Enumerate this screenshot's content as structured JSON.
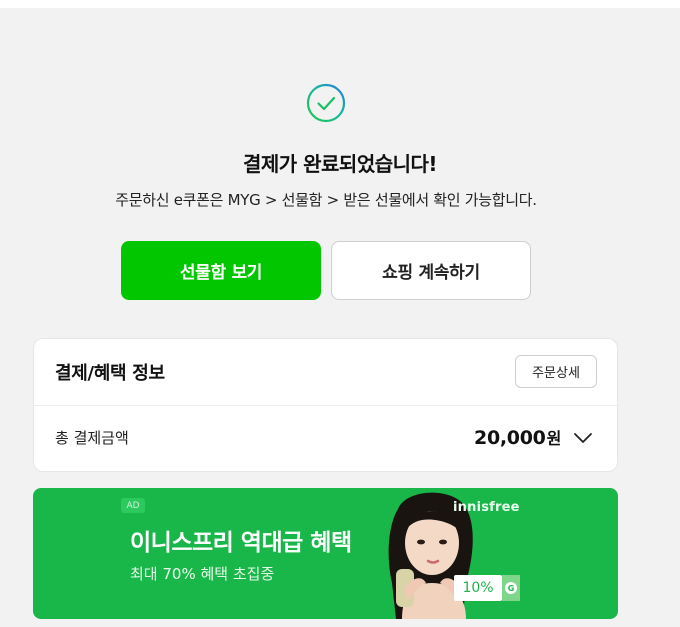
{
  "result": {
    "title": "결제가 완료되었습니다!",
    "subtitle": "주문하신 e쿠폰은 MYG > 선물함 > 받은 선물에서 확인 가능합니다.",
    "icon": "check-circle-icon"
  },
  "actions": {
    "primary_label": "선물함 보기",
    "secondary_label": "쇼핑 계속하기",
    "primary_color": "#02c600"
  },
  "payment_info": {
    "title": "결제/혜택 정보",
    "detail_button": "주문상세",
    "total_label": "총 결제금액",
    "total_amount": "20,000",
    "total_unit": "원",
    "expand_icon": "chevron-down-icon"
  },
  "banner": {
    "badge": "AD",
    "title": "이니스프리 역대급 혜택",
    "subtitle": "최대 70% 혜택 초집중",
    "brand": "innisfree",
    "discount_tag": "10%",
    "tag_icon": "G",
    "background_color": "#19b74a"
  }
}
